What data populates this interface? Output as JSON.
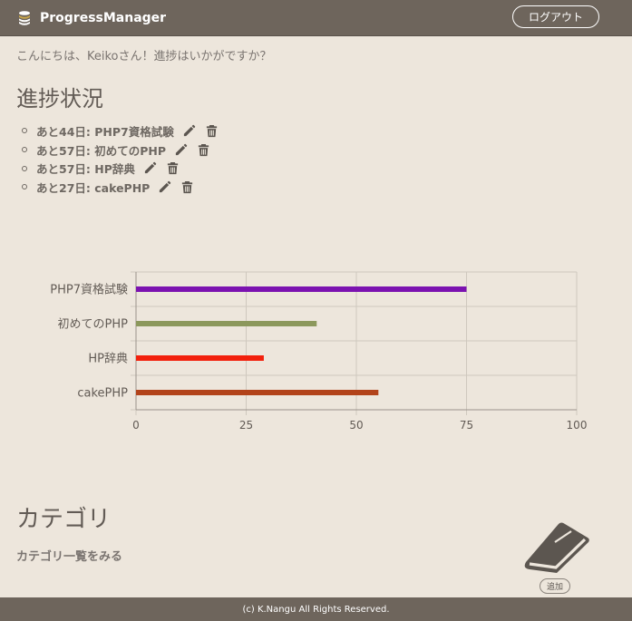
{
  "navbar": {
    "brand": "ProgressManager",
    "brand_icon": "database-stack-icon",
    "logout_label": "ログアウト"
  },
  "greeting": "こんにちは、Keikoさん！進捗はいかがですか？",
  "progress": {
    "heading": "進捗状況",
    "items": [
      {
        "label": "あと44日: PHP7資格試験"
      },
      {
        "label": "あと57日: 初めてのPHP"
      },
      {
        "label": "あと57日: HP辞典"
      },
      {
        "label": "あと27日: cakePHP"
      }
    ],
    "edit_icon": "pencil-icon",
    "delete_icon": "trash-icon"
  },
  "chart_data": {
    "type": "bar",
    "orientation": "horizontal",
    "categories": [
      "PHP7資格試験",
      "初めてのPHP",
      "HP辞典",
      "cakePHP"
    ],
    "values": [
      75,
      41,
      29,
      55
    ],
    "colors": [
      "#7b12b0",
      "#8c985c",
      "#f2200c",
      "#b2431a"
    ],
    "xlim": [
      0,
      100
    ],
    "xticks": [
      "0",
      "25",
      "50",
      "75",
      "100"
    ],
    "grid": true,
    "legend": "none"
  },
  "category": {
    "heading": "カテゴリ",
    "link": "カテゴリ一覧をみる",
    "icon": "book-icon",
    "add_label": "追加"
  },
  "footer": "(c) K.Nangu All Rights Reserved."
}
